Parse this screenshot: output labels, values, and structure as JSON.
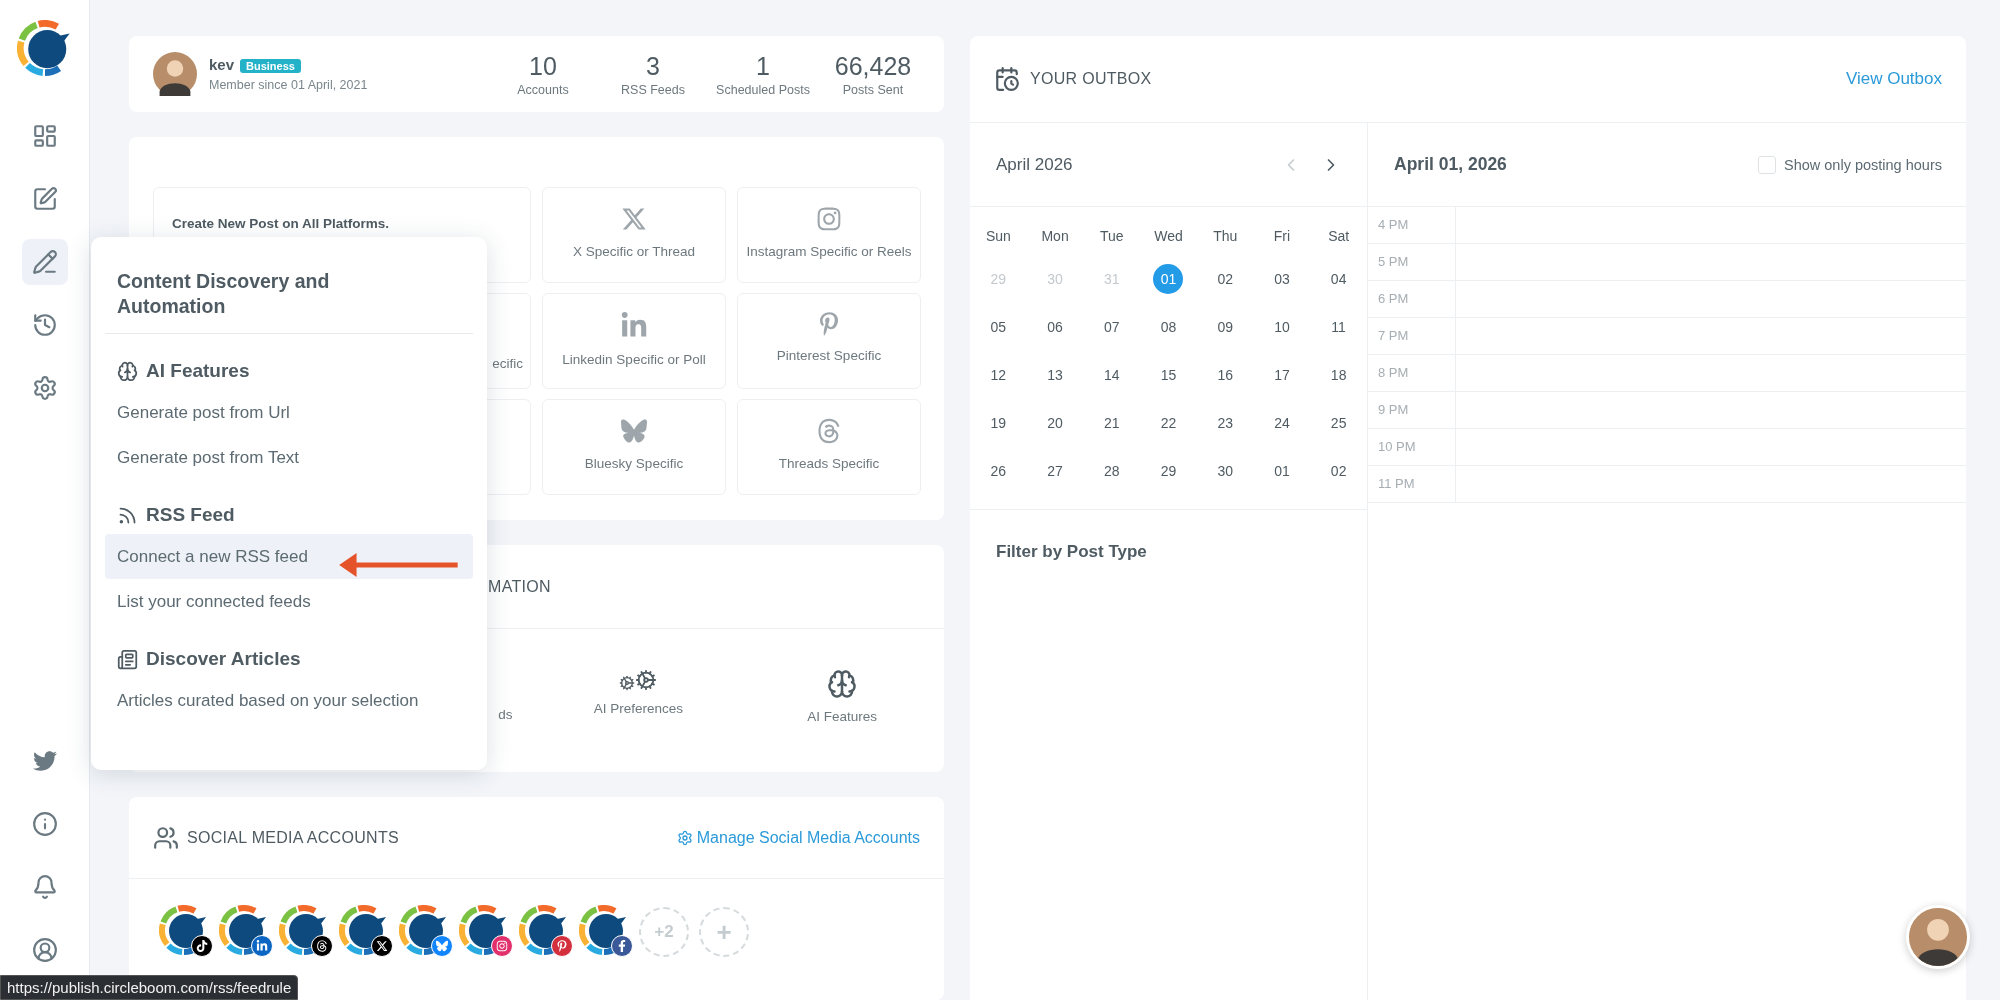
{
  "profile": {
    "name": "kev",
    "badge": "Business",
    "member_since": "Member since 01 April, 2021"
  },
  "stats": [
    {
      "value": "10",
      "label": "Accounts"
    },
    {
      "value": "3",
      "label": "RSS Feeds"
    },
    {
      "value": "1",
      "label": "Scheduled Posts"
    },
    {
      "value": "66,428",
      "label": "Posts Sent"
    }
  ],
  "post_card": {
    "main_tile": "Create New Post on All Platforms.",
    "cut_tile": "ecific",
    "tiles": [
      "X Specific or Thread",
      "Instagram Specific or Reels",
      "Linkedin Specific or Poll",
      "Pinterest Specific",
      "Bluesky Specific",
      "Threads Specific"
    ]
  },
  "automation": {
    "title": "MATION",
    "items": [
      "ds",
      "AI Preferences",
      "AI Features"
    ]
  },
  "social": {
    "title": "SOCIAL MEDIA ACCOUNTS",
    "manage_link": "Manage Social Media Accounts",
    "accounts": [
      {
        "color": "#000000"
      },
      {
        "color": "#0a66c2"
      },
      {
        "color": "#000000"
      },
      {
        "color": "#000000"
      },
      {
        "color": "#1185fe"
      },
      {
        "color": "#e1306c"
      },
      {
        "color": "#d32f3c"
      },
      {
        "color": "#3b5998"
      }
    ],
    "more": "+2",
    "add": "+"
  },
  "popup": {
    "title": "Content Discovery and Automation",
    "sections": [
      {
        "heading": "AI Features",
        "items": [
          {
            "label": "Generate post from Url",
            "selected": false
          },
          {
            "label": "Generate post from Text",
            "selected": false
          }
        ]
      },
      {
        "heading": "RSS Feed",
        "items": [
          {
            "label": "Connect a new RSS feed",
            "selected": true
          },
          {
            "label": "List your connected feeds",
            "selected": false
          }
        ]
      },
      {
        "heading": "Discover Articles",
        "items": [
          {
            "label": "Articles curated based on your selection",
            "selected": false
          }
        ]
      }
    ]
  },
  "outbox": {
    "title": "YOUR OUTBOX",
    "link": "View Outbox",
    "month": "April 2026",
    "weekdays": [
      "Sun",
      "Mon",
      "Tue",
      "Wed",
      "Thu",
      "Fri",
      "Sat"
    ],
    "weeks": [
      [
        {
          "day": "29",
          "outside_month": true,
          "selected": false
        },
        {
          "day": "30",
          "outside_month": true,
          "selected": false
        },
        {
          "day": "31",
          "outside_month": true,
          "selected": false
        },
        {
          "day": "01",
          "outside_month": false,
          "selected": true
        },
        {
          "day": "02",
          "outside_month": false,
          "selected": false
        },
        {
          "day": "03",
          "outside_month": false,
          "selected": false
        },
        {
          "day": "04",
          "outside_month": false,
          "selected": false
        }
      ],
      [
        {
          "day": "05",
          "outside_month": false,
          "selected": false
        },
        {
          "day": "06",
          "outside_month": false,
          "selected": false
        },
        {
          "day": "07",
          "outside_month": false,
          "selected": false
        },
        {
          "day": "08",
          "outside_month": false,
          "selected": false
        },
        {
          "day": "09",
          "outside_month": false,
          "selected": false
        },
        {
          "day": "10",
          "outside_month": false,
          "selected": false
        },
        {
          "day": "11",
          "outside_month": false,
          "selected": false
        }
      ],
      [
        {
          "day": "12",
          "outside_month": false,
          "selected": false
        },
        {
          "day": "13",
          "outside_month": false,
          "selected": false
        },
        {
          "day": "14",
          "outside_month": false,
          "selected": false
        },
        {
          "day": "15",
          "outside_month": false,
          "selected": false
        },
        {
          "day": "16",
          "outside_month": false,
          "selected": false
        },
        {
          "day": "17",
          "outside_month": false,
          "selected": false
        },
        {
          "day": "18",
          "outside_month": false,
          "selected": false
        }
      ],
      [
        {
          "day": "19",
          "outside_month": false,
          "selected": false
        },
        {
          "day": "20",
          "outside_month": false,
          "selected": false
        },
        {
          "day": "21",
          "outside_month": false,
          "selected": false
        },
        {
          "day": "22",
          "outside_month": false,
          "selected": false
        },
        {
          "day": "23",
          "outside_month": false,
          "selected": false
        },
        {
          "day": "24",
          "outside_month": false,
          "selected": false
        },
        {
          "day": "25",
          "outside_month": false,
          "selected": false
        }
      ],
      [
        {
          "day": "26",
          "outside_month": false,
          "selected": false
        },
        {
          "day": "27",
          "outside_month": false,
          "selected": false
        },
        {
          "day": "28",
          "outside_month": false,
          "selected": false
        },
        {
          "day": "29",
          "outside_month": false,
          "selected": false
        },
        {
          "day": "30",
          "outside_month": false,
          "selected": false
        },
        {
          "day": "01",
          "outside_month": false,
          "selected": false
        },
        {
          "day": "02",
          "outside_month": false,
          "selected": false
        }
      ]
    ],
    "filter_title": "Filter by Post Type",
    "day_title": "April 01, 2026",
    "posting_hours": {
      "label": "Show only posting hours",
      "checked": false
    },
    "hours": [
      "4 PM",
      "5 PM",
      "6 PM",
      "7 PM",
      "8 PM",
      "9 PM",
      "10 PM",
      "11 PM"
    ]
  },
  "status_url": "https://publish.circleboom.com/rss/feedrule"
}
